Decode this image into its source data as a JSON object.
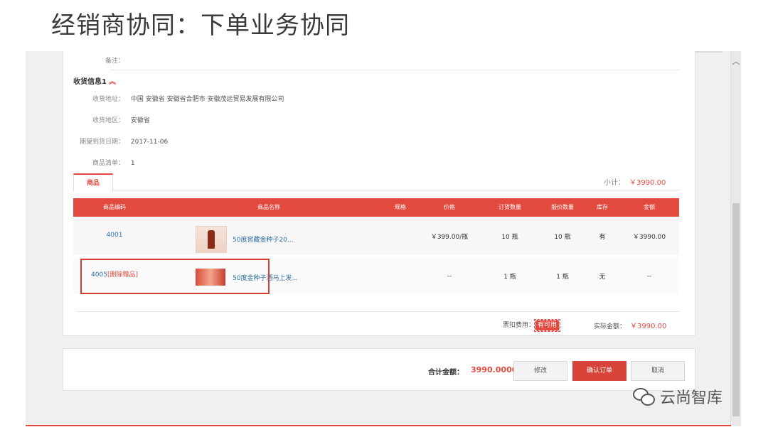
{
  "slide": {
    "title": "经销商协同：下单业务协同"
  },
  "order": {
    "remark_label": "备注：",
    "section_title": "收货信息1",
    "section_icon": "chevron-up-icon",
    "fields": [
      {
        "label": "收货地址：",
        "value": "中国 安徽省 安徽省合肥市 安徽茂远贸易发展有限公司"
      },
      {
        "label": "收货地区：",
        "value": "安徽省"
      },
      {
        "label": "期望到货日期：",
        "value": "2017-11-06"
      },
      {
        "label": "商品清单：",
        "value": "1"
      }
    ],
    "tab": "商品",
    "subtotal_label": "小计：",
    "subtotal_value": "￥3990.00",
    "columns": [
      "商品编码",
      "商品名称",
      "规格",
      "价格",
      "订货数量",
      "报价数量",
      "库存",
      "金额"
    ],
    "rows": [
      {
        "code": "4001",
        "tag": "",
        "name": "50度窖藏金种子20...",
        "spec": "",
        "price": "￥399.00/瓶",
        "qty": "10 瓶",
        "quote": "10 瓶",
        "stock": "有",
        "amount": "￥3990.00"
      },
      {
        "code": "4005",
        "tag": "[删除赠品]",
        "name": "50度金种子酒马上发...",
        "spec": "",
        "price": "--",
        "qty": "1 瓶",
        "quote": "1 瓶",
        "stock": "无",
        "amount": "--"
      }
    ],
    "fee_label": "票扣费用：",
    "fee_badge": "有可用",
    "actual_label": "实际金额：",
    "actual_value": "￥3990.00"
  },
  "footer": {
    "total_label": "合计金额：",
    "total_value": "3990.0000",
    "btn_modify": "修改",
    "btn_confirm": "确认订单",
    "btn_cancel": "取消"
  },
  "watermark": {
    "text": "云尚智库",
    "icon": "wechat-icon"
  },
  "colors": {
    "accent": "#e24a3f",
    "link": "#2e6da4"
  }
}
